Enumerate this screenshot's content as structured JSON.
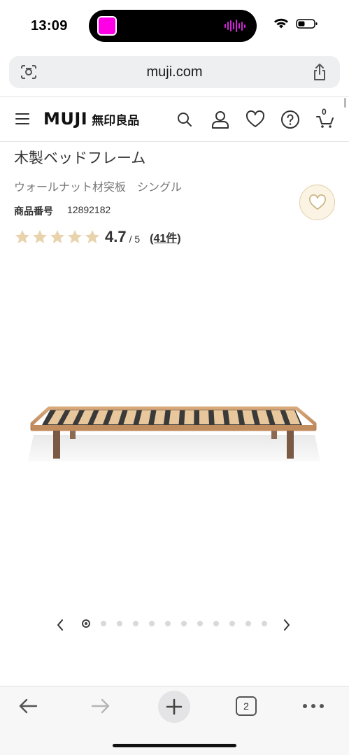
{
  "status_bar": {
    "time": "13:09"
  },
  "browser": {
    "url": "muji.com",
    "tab_count": "2"
  },
  "header": {
    "logo_en": "MUJI",
    "logo_jp": "無印良品",
    "cart_count": "0",
    "icons": [
      "menu-icon",
      "search-icon",
      "account-icon",
      "heart-icon",
      "help-icon",
      "cart-icon"
    ]
  },
  "product": {
    "title": "木製ベッドフレーム",
    "subtitle": "ウォールナット材突板　シングル",
    "number_label": "商品番号",
    "number_value": "12892182",
    "rating_value": "4.7",
    "rating_max": "/ 5",
    "review_count": "(41件)",
    "stars_filled": 5,
    "star_color": "#e8d3ad"
  },
  "carousel": {
    "total": 12,
    "active_index": 0
  },
  "colors": {
    "accent": "#e2cfa8",
    "island_app": "#ff00e6"
  }
}
